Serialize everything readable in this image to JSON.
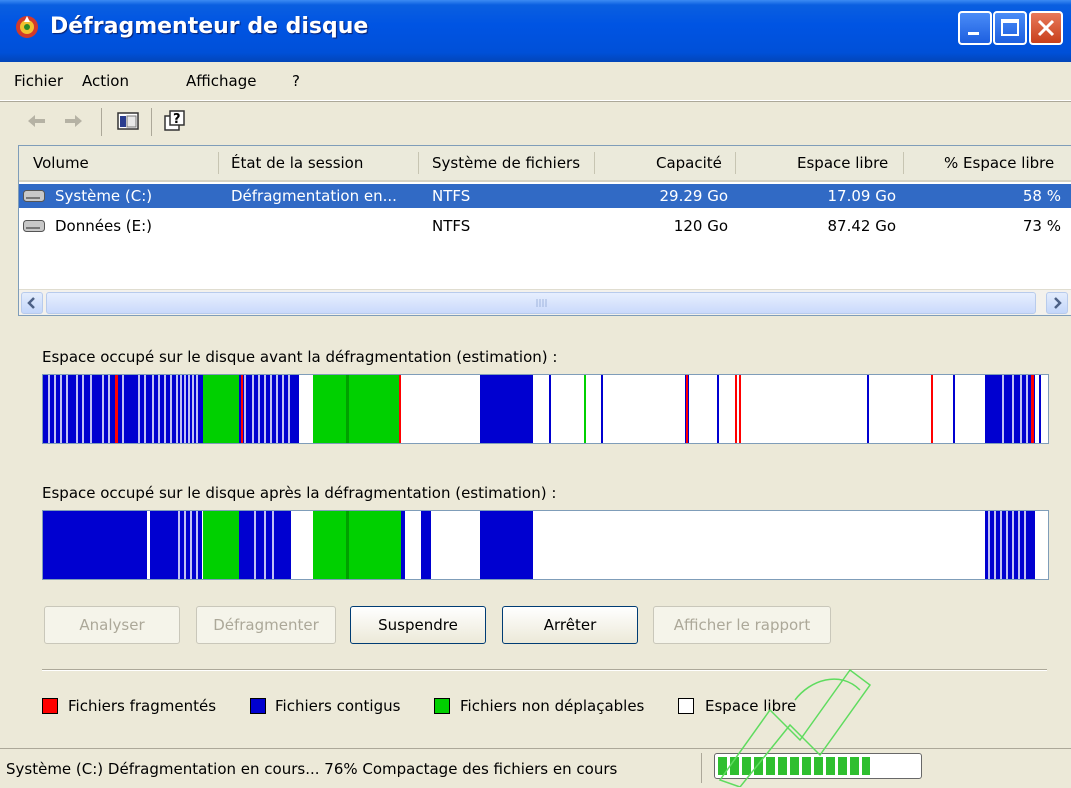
{
  "window": {
    "title": "Défragmenteur de disque"
  },
  "menu": {
    "items": [
      "Fichier",
      "Action",
      "Affichage",
      "?"
    ]
  },
  "toolbar": {
    "icons": [
      "back-arrow-icon",
      "forward-arrow-icon",
      "show-hide-console-icon",
      "help-icon"
    ]
  },
  "list": {
    "columns": [
      "Volume",
      "État de la session",
      "Système de fichiers",
      "Capacité",
      "Espace libre",
      "% Espace libre"
    ],
    "rows": [
      {
        "volume": "Système (C:)",
        "status": "Défragmentation en...",
        "fs": "NTFS",
        "capacity": "29.29 Go",
        "free": "17.09 Go",
        "pct": "58 %",
        "selected": true
      },
      {
        "volume": "Données (E:)",
        "status": "",
        "fs": "NTFS",
        "capacity": "120 Go",
        "free": "87.42 Go",
        "pct": "73 %",
        "selected": false
      }
    ]
  },
  "maps": {
    "before_label": "Espace occupé sur le disque avant la défragmentation (estimation) :",
    "after_label": "Espace occupé sur le disque après la défragmentation (estimation) :"
  },
  "buttons": {
    "analyze": "Analyser",
    "defrag": "Défragmenter",
    "pause": "Suspendre",
    "stop": "Arrêter",
    "report": "Afficher le rapport"
  },
  "legend": {
    "fragmented": "Fichiers fragmentés",
    "contiguous": "Fichiers contigus",
    "unmovable": "Fichiers non déplaçables",
    "free": "Espace libre"
  },
  "colors": {
    "fragmented": "#ff0000",
    "contiguous": "#0000d0",
    "unmovable": "#00d000",
    "free": "#ffffff",
    "selection": "#316ac5"
  },
  "status": {
    "text": "Système (C:) Défragmentation en cours... 76%  Compactage des fichiers en cours",
    "progress_fraction": 0.76
  }
}
